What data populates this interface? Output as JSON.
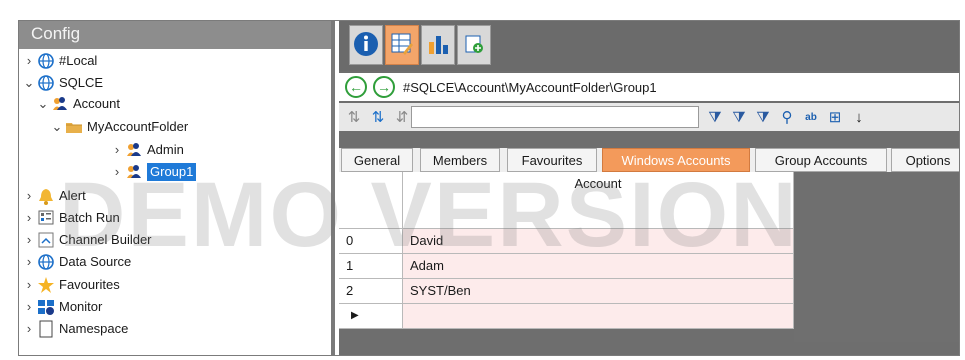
{
  "config_header": "Config",
  "tree": {
    "items": [
      {
        "label": "#Local",
        "icon": "globe-icon",
        "chevron": "›"
      },
      {
        "label": "SQLCE",
        "icon": "globe-icon",
        "chevron": "⌄"
      },
      {
        "label": "Account",
        "icon": "users-icon",
        "chevron": "⌄"
      },
      {
        "label": "MyAccountFolder",
        "icon": "folder-icon",
        "chevron": "⌄"
      },
      {
        "label": "Admin",
        "icon": "users-icon",
        "chevron": "›"
      },
      {
        "label": "Group1",
        "icon": "users-icon",
        "chevron": "›",
        "selected": true
      },
      {
        "label": "Alert",
        "icon": "bell-icon",
        "chevron": "›"
      },
      {
        "label": "Batch Run",
        "icon": "batch-icon",
        "chevron": "›"
      },
      {
        "label": "Channel Builder",
        "icon": "channel-icon",
        "chevron": "›"
      },
      {
        "label": "Data Source",
        "icon": "globe-icon",
        "chevron": "›"
      },
      {
        "label": "Favourites",
        "icon": "star-icon",
        "chevron": "›"
      },
      {
        "label": "Monitor",
        "icon": "monitor-icon",
        "chevron": "›"
      },
      {
        "label": "Namespace",
        "icon": "page-icon",
        "chevron": "›"
      }
    ]
  },
  "toolbar": {
    "buttons": [
      "info-icon",
      "edit-grid-icon",
      "chart-icon",
      "new-page-icon"
    ]
  },
  "nav": {
    "back": "←",
    "forward": "→",
    "path": "#SQLCE\\Account\\MyAccountFolder\\Group1"
  },
  "filter": {
    "value": "",
    "icons": [
      "filter-icon",
      "filter-clear-icon",
      "filter-up-icon",
      "search-icon",
      "replace-icon",
      "grid-export-icon",
      "sort-az-icon"
    ]
  },
  "tabs": [
    "General",
    "Members",
    "Favourites",
    "Windows Accounts",
    "Group Accounts",
    "Options"
  ],
  "active_tab": "Windows Accounts",
  "grid": {
    "column_header": "Account",
    "rows": [
      {
        "index": "0",
        "account": "David"
      },
      {
        "index": "1",
        "account": "Adam"
      },
      {
        "index": "2",
        "account": "SYST/Ben"
      }
    ],
    "new_row_marker": "▶"
  },
  "watermark": "DEMO VERSION",
  "colors": {
    "accent": "#f39a5b",
    "selection": "#1f7ad8",
    "grid_cell": "#fdebeb"
  }
}
